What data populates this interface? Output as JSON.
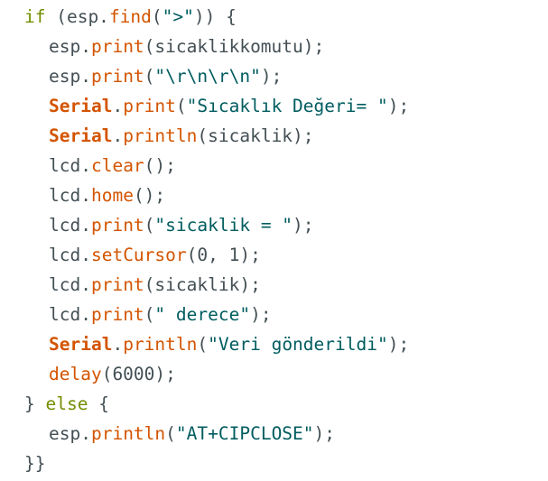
{
  "editor": {
    "lines": [
      {
        "indent": 0,
        "tokens": [
          {
            "t": "kw",
            "v": "if"
          },
          {
            "t": "plain",
            "v": " (esp."
          },
          {
            "t": "fn",
            "v": "find"
          },
          {
            "t": "plain",
            "v": "("
          },
          {
            "t": "str",
            "v": "\">\""
          },
          {
            "t": "plain",
            "v": ")) {"
          }
        ]
      },
      {
        "indent": 1,
        "tokens": [
          {
            "t": "plain",
            "v": "esp."
          },
          {
            "t": "fn",
            "v": "print"
          },
          {
            "t": "plain",
            "v": "(sicaklikkomutu);"
          }
        ]
      },
      {
        "indent": 1,
        "tokens": [
          {
            "t": "plain",
            "v": "esp."
          },
          {
            "t": "fn",
            "v": "print"
          },
          {
            "t": "plain",
            "v": "("
          },
          {
            "t": "str",
            "v": "\"\\r\\n\\r\\n\""
          },
          {
            "t": "plain",
            "v": ");"
          }
        ]
      },
      {
        "indent": 1,
        "tokens": [
          {
            "t": "obj",
            "v": "Serial"
          },
          {
            "t": "plain",
            "v": "."
          },
          {
            "t": "fn",
            "v": "print"
          },
          {
            "t": "plain",
            "v": "("
          },
          {
            "t": "str",
            "v": "\"Sıcaklık Değeri= \""
          },
          {
            "t": "plain",
            "v": ");"
          }
        ]
      },
      {
        "indent": 1,
        "tokens": [
          {
            "t": "obj",
            "v": "Serial"
          },
          {
            "t": "plain",
            "v": "."
          },
          {
            "t": "fn",
            "v": "println"
          },
          {
            "t": "plain",
            "v": "(sicaklik);"
          }
        ]
      },
      {
        "indent": 1,
        "tokens": [
          {
            "t": "plain",
            "v": "lcd."
          },
          {
            "t": "fn",
            "v": "clear"
          },
          {
            "t": "plain",
            "v": "();"
          }
        ]
      },
      {
        "indent": 1,
        "tokens": [
          {
            "t": "plain",
            "v": "lcd."
          },
          {
            "t": "fn",
            "v": "home"
          },
          {
            "t": "plain",
            "v": "();"
          }
        ]
      },
      {
        "indent": 1,
        "tokens": [
          {
            "t": "plain",
            "v": "lcd."
          },
          {
            "t": "fn",
            "v": "print"
          },
          {
            "t": "plain",
            "v": "("
          },
          {
            "t": "str",
            "v": "\"sicaklik = \""
          },
          {
            "t": "plain",
            "v": ");"
          }
        ]
      },
      {
        "indent": 1,
        "tokens": [
          {
            "t": "plain",
            "v": "lcd."
          },
          {
            "t": "fn",
            "v": "setCursor"
          },
          {
            "t": "plain",
            "v": "(0, 1);"
          }
        ]
      },
      {
        "indent": 1,
        "tokens": [
          {
            "t": "plain",
            "v": "lcd."
          },
          {
            "t": "fn",
            "v": "print"
          },
          {
            "t": "plain",
            "v": "(sicaklik);"
          }
        ]
      },
      {
        "indent": 1,
        "tokens": [
          {
            "t": "plain",
            "v": "lcd."
          },
          {
            "t": "fn",
            "v": "print"
          },
          {
            "t": "plain",
            "v": "("
          },
          {
            "t": "str",
            "v": "\" derece\""
          },
          {
            "t": "plain",
            "v": ");"
          }
        ]
      },
      {
        "indent": 1,
        "tokens": [
          {
            "t": "obj",
            "v": "Serial"
          },
          {
            "t": "plain",
            "v": "."
          },
          {
            "t": "fn",
            "v": "println"
          },
          {
            "t": "plain",
            "v": "("
          },
          {
            "t": "str",
            "v": "\"Veri gönderildi\""
          },
          {
            "t": "plain",
            "v": ");"
          }
        ]
      },
      {
        "indent": 1,
        "tokens": [
          {
            "t": "fn",
            "v": "delay"
          },
          {
            "t": "plain",
            "v": "(6000);"
          }
        ]
      },
      {
        "indent": 0,
        "tokens": [
          {
            "t": "plain",
            "v": "} "
          },
          {
            "t": "kw",
            "v": "else"
          },
          {
            "t": "plain",
            "v": " {"
          }
        ]
      },
      {
        "indent": 1,
        "tokens": [
          {
            "t": "plain",
            "v": "esp."
          },
          {
            "t": "fn",
            "v": "println"
          },
          {
            "t": "plain",
            "v": "("
          },
          {
            "t": "str",
            "v": "\"AT+CIPCLOSE\""
          },
          {
            "t": "plain",
            "v": ");"
          }
        ]
      },
      {
        "indent": 0,
        "tokens": [
          {
            "t": "plain",
            "v": "}}"
          }
        ]
      }
    ]
  },
  "colors": {
    "keyword": "#728e00",
    "function": "#d35400",
    "string": "#005c5f",
    "object": "#d35400",
    "plain": "#434f54",
    "background": "#ffffff"
  }
}
